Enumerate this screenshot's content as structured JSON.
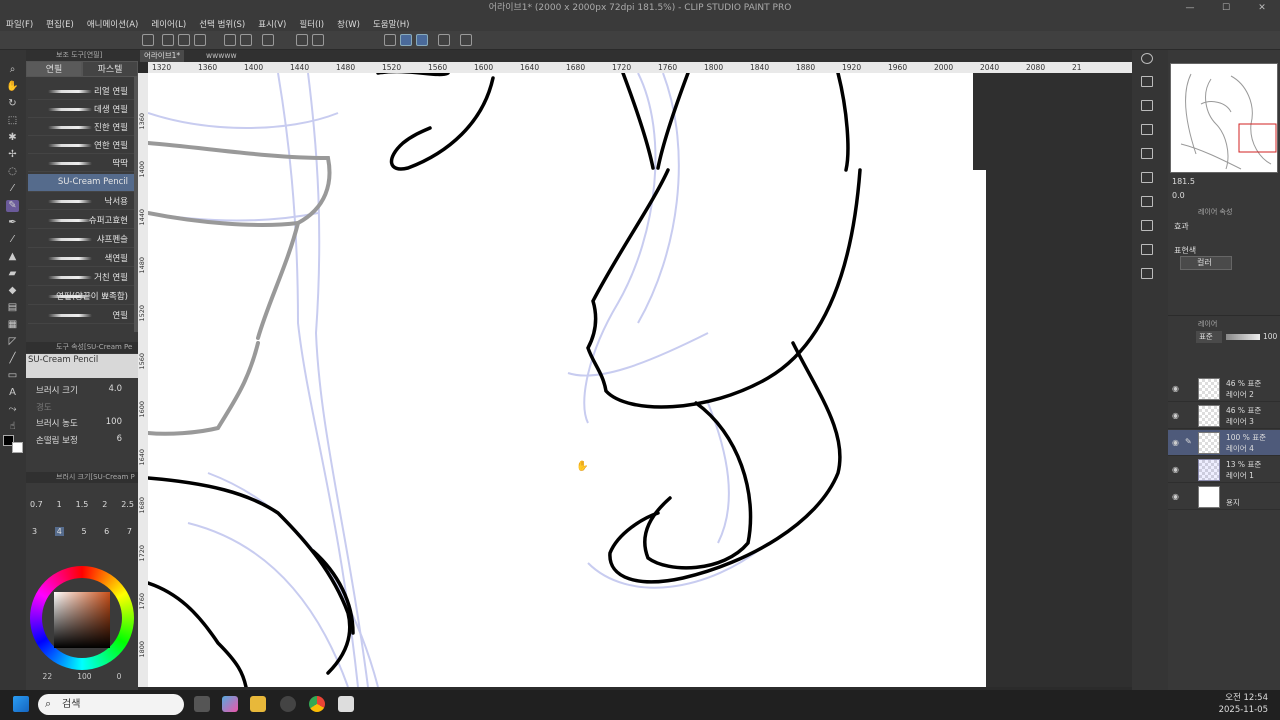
{
  "titlebar": {
    "title": "어라이브1* (2000 x 2000px 72dpi 181.5%) - CLIP STUDIO PAINT PRO"
  },
  "window_controls": [
    "—",
    "☐",
    "✕"
  ],
  "menu": [
    "파일(F)",
    "편집(E)",
    "애니메이션(A)",
    "레이어(L)",
    "선택 범위(S)",
    "표시(V)",
    "필터(I)",
    "창(W)",
    "도움말(H)"
  ],
  "subtool_panel": {
    "header": "보조 도구[연필]",
    "tabs": [
      "연필",
      "파스텔"
    ],
    "brushes": [
      "리얼 연필",
      "데생 연필",
      "진한 연필",
      "연한 연필",
      "딱딱",
      "SU-Cream Pencil",
      "낙서용",
      "슈퍼고효현",
      "샤프펜슬",
      "색연필",
      "거친 연필",
      "연필(양끝이 뾰족함)",
      "연필"
    ],
    "selected_index": 5
  },
  "tool_property": {
    "header": "도구 속성[SU-Cream Pe",
    "brush_name": "SU-Cream Pencil",
    "brush_size_label": "브러시 크기",
    "brush_size_value": "4.0",
    "hardness_label": "경도",
    "density_label": "브러시 농도",
    "density_value": "100",
    "stabilization_label": "손떨림 보정",
    "stabilization_value": "6"
  },
  "brush_size_panel": {
    "header": "브러시 크기[SU-Cream P",
    "sizes_row1": [
      "0.7",
      "1",
      "1.5",
      "2",
      "2.5"
    ],
    "sizes_row2": [
      "3",
      "4",
      "5",
      "6",
      "7"
    ],
    "selected": "4"
  },
  "color_panel": {
    "hue_accent": "#c8501a",
    "fg_color": "#000000",
    "bg_color": "#ffffff",
    "footer_values": [
      "22",
      "100",
      "0"
    ]
  },
  "doc_tabs": [
    "어라이브1*",
    "wwwww"
  ],
  "ruler": {
    "ticks": [
      "1320",
      "1360",
      "1400",
      "1440",
      "1480",
      "1520",
      "1560",
      "1600",
      "1640",
      "1680",
      "1720",
      "1760",
      "1800",
      "1840",
      "1880",
      "1920",
      "1960",
      "2000",
      "2040",
      "2080",
      "21"
    ]
  },
  "vruler": {
    "ticks": [
      "1360",
      "1400",
      "1440",
      "1480",
      "1520",
      "1560",
      "1600",
      "1640",
      "1680",
      "1720",
      "1760",
      "1800"
    ]
  },
  "navigator": {
    "zoom": "181.5",
    "rotation": "0.0"
  },
  "layer_property": {
    "header": "레이어 속성",
    "effect_label": "효과",
    "expression_label": "표현색",
    "expression_value": "컬러"
  },
  "layers_panel": {
    "header": "레이어",
    "blend_mode": "표준",
    "opacity": "100",
    "layers": [
      {
        "top": "46 % 표준",
        "name": "레이어 2"
      },
      {
        "top": "46 % 표준",
        "name": "레이어 3"
      },
      {
        "top": "100 % 표준",
        "name": "레이어 4"
      },
      {
        "top": "13 % 표준",
        "name": "레이어 1"
      },
      {
        "top": "",
        "name": "용지"
      }
    ],
    "selected_index": 2
  },
  "taskbar": {
    "search_placeholder": "검색",
    "time": "오전 12:54",
    "date": "2025-11-05"
  }
}
